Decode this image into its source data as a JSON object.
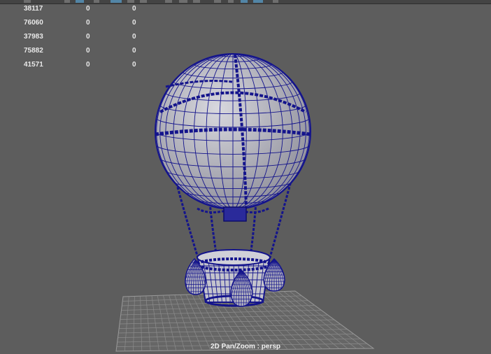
{
  "hud": {
    "rows": [
      {
        "c1": "38117",
        "c2": "0",
        "c3": "0"
      },
      {
        "c1": "76060",
        "c2": "0",
        "c3": "0"
      },
      {
        "c1": "37983",
        "c2": "0",
        "c3": "0"
      },
      {
        "c1": "75882",
        "c2": "0",
        "c3": "0"
      },
      {
        "c1": "41571",
        "c2": "0",
        "c3": "0"
      }
    ]
  },
  "viewport": {
    "camera_label": "2D Pan/Zoom : persp",
    "background_color": "#5d5d5d",
    "wire_color": "#14148c",
    "model_fill_color": "#b9b9c2",
    "grid_color": "#9a9a9a"
  },
  "toolbar": {
    "active_color": "#5285a6"
  }
}
